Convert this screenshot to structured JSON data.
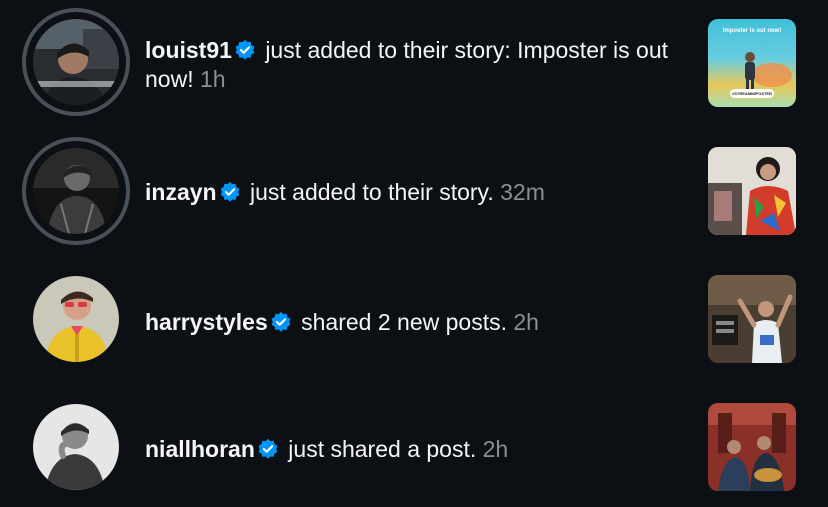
{
  "notifications": [
    {
      "username": "louist91",
      "message": "just added to their story: Imposter is out now!",
      "time": "1h",
      "avatar_icon": "person-in-car",
      "thumbnail": {
        "headline": "Imposter is out now!",
        "caption": "#STREAMIMPOSTER"
      }
    },
    {
      "username": "inzayn",
      "message": "just added to their story.",
      "time": "32m",
      "avatar_icon": "person-bw"
    },
    {
      "username": "harrystyles",
      "message": "shared 2 new posts.",
      "time": "2h",
      "avatar_icon": "person-yellow-jacket"
    },
    {
      "username": "niallhoran",
      "message": "just shared a post.",
      "time": "2h",
      "avatar_icon": "person-bw-portrait"
    }
  ],
  "colors": {
    "background": "#0c1014",
    "verified": "#0095f6",
    "muted_text": "#8e8e8e",
    "story_ring": "#4a5058"
  }
}
